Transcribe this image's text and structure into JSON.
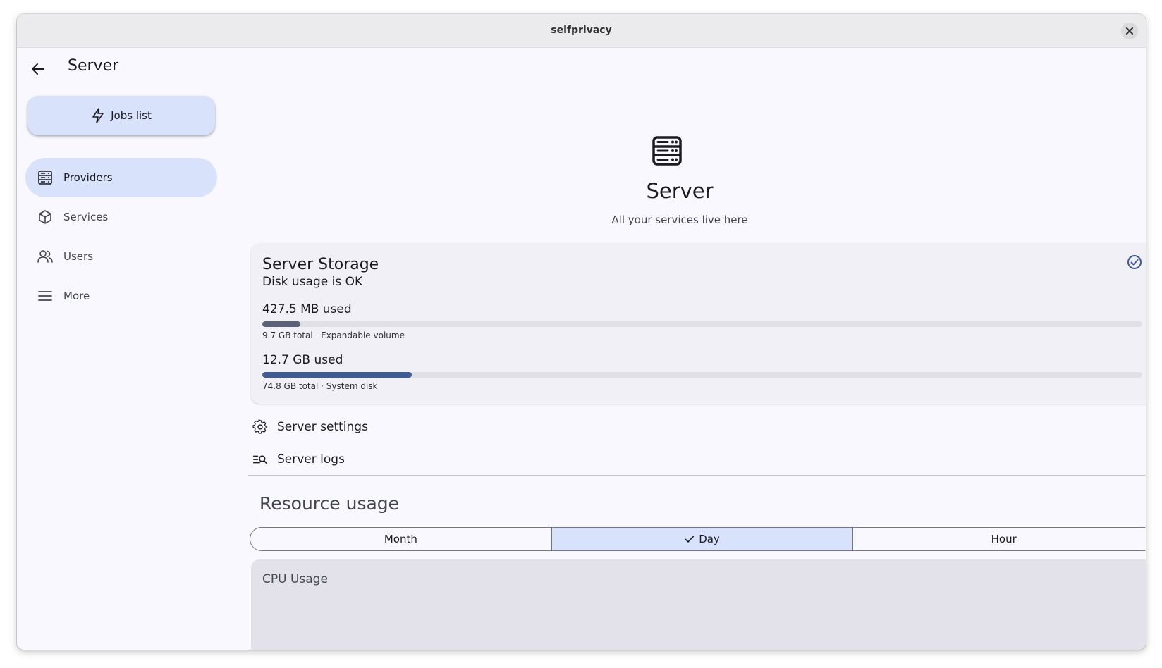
{
  "window": {
    "title": "selfprivacy"
  },
  "sidebar": {
    "page_title": "Server",
    "jobs_button": "Jobs list",
    "items": [
      {
        "label": "Providers",
        "icon": "server-icon",
        "active": true
      },
      {
        "label": "Services",
        "icon": "box-icon",
        "active": false
      },
      {
        "label": "Users",
        "icon": "users-icon",
        "active": false
      },
      {
        "label": "More",
        "icon": "menu-icon",
        "active": false
      }
    ]
  },
  "hero": {
    "title": "Server",
    "subtitle": "All your services live here"
  },
  "storage": {
    "title": "Server Storage",
    "status": "Disk usage is OK",
    "disks": [
      {
        "used": "427.5 MB used",
        "meta": "9.7 GB total · Expandable volume",
        "fraction": 0.043,
        "color": "#5b6177"
      },
      {
        "used": "12.7 GB used",
        "meta": "74.8 GB total · System disk",
        "fraction": 0.17,
        "color": "#3f5b94"
      }
    ]
  },
  "links": {
    "settings": "Server settings",
    "logs": "Server logs"
  },
  "resources": {
    "title": "Resource usage",
    "periods": [
      "Month",
      "Day",
      "Hour"
    ],
    "selected": "Day"
  },
  "cpu": {
    "title": "CPU Usage"
  },
  "colors": {
    "accent_container": "#d9e2fb",
    "background": "#f9f8fe",
    "card": "#f1f0f6"
  }
}
